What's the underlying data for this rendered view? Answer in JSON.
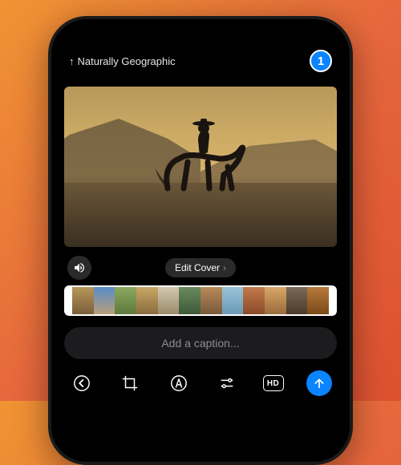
{
  "header": {
    "share_arrow": "↑",
    "share_label": "Naturally Geographic",
    "badge_count": "1"
  },
  "controls": {
    "edit_cover_label": "Edit Cover",
    "caption_placeholder": "Add a caption...",
    "hd_label": "HD"
  },
  "thumbnails": [
    {
      "bg": "linear-gradient(#b8975a,#7a5e3a)"
    },
    {
      "bg": "linear-gradient(#5a8cc9,#b89f7a)"
    },
    {
      "bg": "linear-gradient(#8aa85e,#5e7a3e)"
    },
    {
      "bg": "linear-gradient(#c9a864,#8a6b3e)"
    },
    {
      "bg": "linear-gradient(#d4c9b0,#9a8a6a)"
    },
    {
      "bg": "linear-gradient(#6a8a5e,#3e5a3a)"
    },
    {
      "bg": "linear-gradient(#b88a5a,#7a5a3a)"
    },
    {
      "bg": "linear-gradient(#9ac4d9,#6a9ab8)"
    },
    {
      "bg": "linear-gradient(#c47a4a,#8a4a2a)"
    },
    {
      "bg": "linear-gradient(#d9a86a,#9a6a3a)"
    },
    {
      "bg": "linear-gradient(#7a6a5a,#4a3a2a)"
    },
    {
      "bg": "linear-gradient(#b87a3a,#7a4a1a)"
    }
  ],
  "icons": {
    "sound": "sound-on",
    "back": "chevron-left",
    "crop": "crop",
    "markup": "markup",
    "adjust": "adjust",
    "hd": "hd",
    "send": "arrow-up"
  },
  "colors": {
    "accent": "#0a84ff",
    "background": "#000000",
    "placeholder": "#8e8e93"
  }
}
